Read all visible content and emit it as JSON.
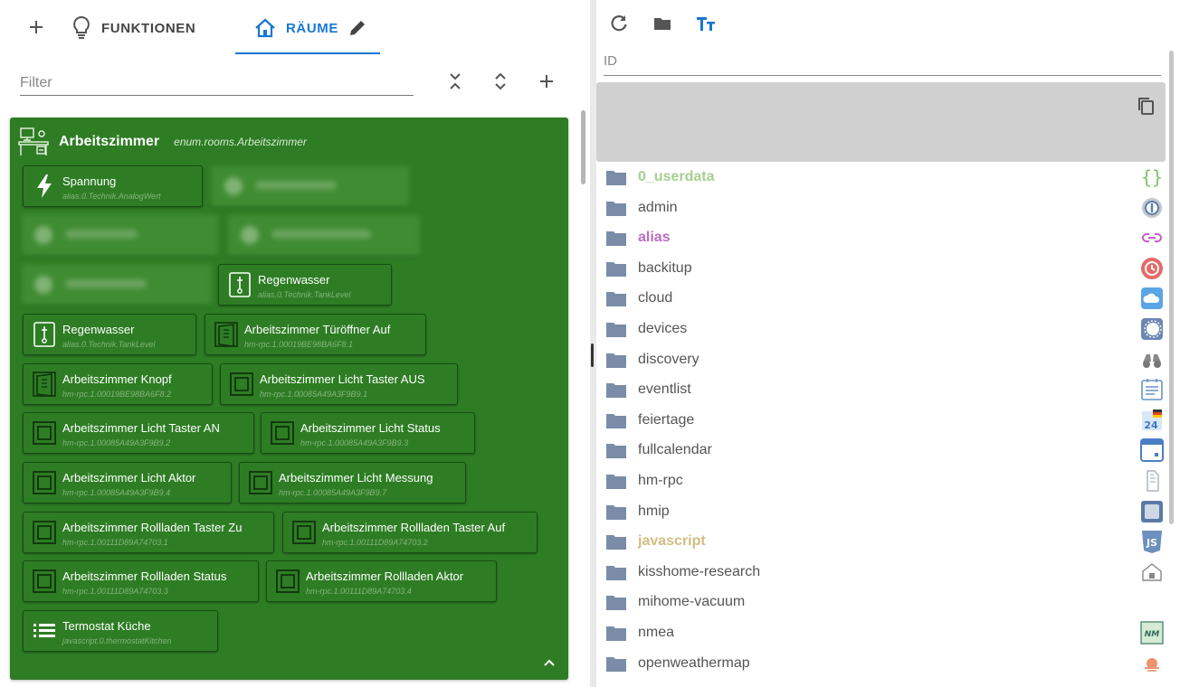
{
  "left": {
    "tabs": {
      "add_label": "+",
      "functions_label": "FUNKTIONEN",
      "rooms_label": "RÄUME"
    },
    "filter": {
      "placeholder": "Filter"
    },
    "room": {
      "title": "Arbeitszimmer",
      "id": "enum.rooms.Arbeitszimmer",
      "cards": [
        {
          "name": "Spannung",
          "id": "alias.0.Technik.AnalogWert",
          "icon": "lightning-icon"
        },
        {
          "name": "Regenwasser",
          "id": "alias.0.Technik.TankLevel",
          "icon": "tank-level-icon"
        },
        {
          "name": "Regenwasser",
          "id": "alias.0.Technik.TankLevel",
          "icon": "tank-level-icon"
        },
        {
          "name": "Arbeitszimmer Türöffner Auf",
          "id": "hm-rpc.1.00019BE98BA6F8.1",
          "icon": "door-switch-icon"
        },
        {
          "name": "Arbeitszimmer Knopf",
          "id": "hm-rpc.1.00019BE98BA6F8.2",
          "icon": "door-switch-icon"
        },
        {
          "name": "Arbeitszimmer Licht Taster AUS",
          "id": "hm-rpc.1.00085A49A3F9B9.1",
          "icon": "wall-switch-icon"
        },
        {
          "name": "Arbeitszimmer Licht Taster AN",
          "id": "hm-rpc.1.00085A49A3F9B9.2",
          "icon": "wall-switch-icon"
        },
        {
          "name": "Arbeitszimmer Licht Status",
          "id": "hm-rpc.1.00085A49A3F9B9.3",
          "icon": "wall-switch-icon"
        },
        {
          "name": "Arbeitszimmer Licht Aktor",
          "id": "hm-rpc.1.00085A49A3F9B9.4",
          "icon": "wall-switch-icon"
        },
        {
          "name": "Arbeitszimmer Licht Messung",
          "id": "hm-rpc.1.00085A49A3F9B9.7",
          "icon": "wall-switch-icon"
        },
        {
          "name": "Arbeitszimmer Rollladen Taster Zu",
          "id": "hm-rpc.1.00111D89A74703.1",
          "icon": "wall-switch-icon"
        },
        {
          "name": "Arbeitszimmer Rollladen Taster Auf",
          "id": "hm-rpc.1.00111D89A74703.2",
          "icon": "wall-switch-icon"
        },
        {
          "name": "Arbeitszimmer Rollladen Status",
          "id": "hm-rpc.1.00111D89A74703.3",
          "icon": "wall-switch-icon"
        },
        {
          "name": "Arbeitszimmer Rollladen Aktor",
          "id": "hm-rpc.1.00111D89A74703.4",
          "icon": "wall-switch-icon"
        },
        {
          "name": "Termostat Küche",
          "id": "javascript.0.thermostatKitchen",
          "icon": "list-icon"
        }
      ]
    }
  },
  "right": {
    "id_label": "ID",
    "tree": [
      {
        "name": "0_userdata",
        "style": "green",
        "icon": "curly-braces-icon"
      },
      {
        "name": "admin",
        "style": "normal",
        "icon": "admin-gear-icon"
      },
      {
        "name": "alias",
        "style": "purple",
        "icon": "link-icon"
      },
      {
        "name": "backitup",
        "style": "normal",
        "icon": "backitup-icon"
      },
      {
        "name": "cloud",
        "style": "normal",
        "icon": "cloud-icon"
      },
      {
        "name": "devices",
        "style": "normal",
        "icon": "devices-icon"
      },
      {
        "name": "discovery",
        "style": "normal",
        "icon": "binoculars-icon"
      },
      {
        "name": "eventlist",
        "style": "normal",
        "icon": "eventlist-icon"
      },
      {
        "name": "feiertage",
        "style": "normal",
        "icon": "calendar-24-icon"
      },
      {
        "name": "fullcalendar",
        "style": "normal",
        "icon": "fullcalendar-icon"
      },
      {
        "name": "hm-rpc",
        "style": "normal",
        "icon": "hm-rpc-icon"
      },
      {
        "name": "hmip",
        "style": "normal",
        "icon": "hmip-icon"
      },
      {
        "name": "javascript",
        "style": "gold",
        "icon": "js-icon"
      },
      {
        "name": "kisshome-research",
        "style": "normal",
        "icon": "kisshome-icon"
      },
      {
        "name": "mihome-vacuum",
        "style": "normal",
        "icon": "none"
      },
      {
        "name": "nmea",
        "style": "normal",
        "icon": "nmea-icon"
      },
      {
        "name": "openweathermap",
        "style": "normal",
        "icon": "weather-icon"
      }
    ]
  },
  "colors": {
    "accent": "#1976d2",
    "room_bg": "#2e7d24",
    "card_border": "#174d13"
  }
}
